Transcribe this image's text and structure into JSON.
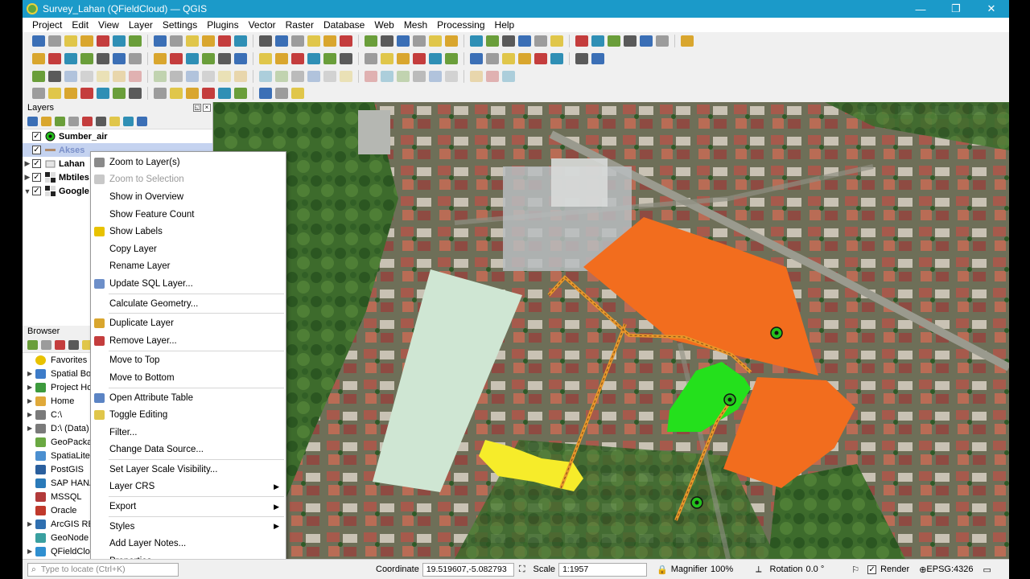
{
  "window": {
    "title": "Survey_Lahan (QFieldCloud) — QGIS",
    "controls": [
      "—",
      "❐",
      "✕"
    ]
  },
  "menubar": [
    "Project",
    "Edit",
    "View",
    "Layer",
    "Settings",
    "Plugins",
    "Vector",
    "Raster",
    "Database",
    "Web",
    "Mesh",
    "Processing",
    "Help"
  ],
  "layers_panel": {
    "title": "Layers",
    "layers": [
      {
        "name": "Sumber_air",
        "checked": true,
        "icon": "point-layer-icon"
      },
      {
        "name": "Akses",
        "checked": true,
        "icon": "line-layer-icon",
        "selected": true
      },
      {
        "name": "Lahan",
        "checked": true,
        "icon": "polygon-layer-icon"
      },
      {
        "name": "Mbtiles",
        "checked": true,
        "icon": "raster-layer-icon"
      },
      {
        "name": "Google",
        "checked": true,
        "icon": "raster-layer-icon"
      }
    ]
  },
  "browser_panel": {
    "title": "Browser",
    "items": [
      "Favorites",
      "Spatial Bookmarks",
      "Project Home",
      "Home",
      "C:\\",
      "D:\\ (Data)",
      "GeoPackage",
      "SpatiaLite",
      "PostGIS",
      "SAP HANA",
      "MSSQL",
      "Oracle",
      "ArcGIS REST Servers",
      "GeoNode",
      "QFieldCloud"
    ]
  },
  "context_menu": {
    "groups": [
      [
        {
          "label": "Zoom to Layer(s)",
          "icon": "zoom-layer-icon"
        },
        {
          "label": "Zoom to Selection",
          "icon": "zoom-selection-icon",
          "disabled": true
        },
        {
          "label": "Show in Overview",
          "icon": ""
        },
        {
          "label": "Show Feature Count",
          "icon": ""
        },
        {
          "label": "Show Labels",
          "icon": "labels-icon"
        },
        {
          "label": "Copy Layer",
          "icon": ""
        },
        {
          "label": "Rename Layer",
          "icon": ""
        },
        {
          "label": "Update SQL Layer...",
          "icon": "database-icon"
        }
      ],
      [
        {
          "label": "Calculate Geometry...",
          "icon": ""
        }
      ],
      [
        {
          "label": "Duplicate Layer",
          "icon": "duplicate-icon"
        },
        {
          "label": "Remove Layer...",
          "icon": "remove-icon"
        }
      ],
      [
        {
          "label": "Move to Top",
          "icon": ""
        },
        {
          "label": "Move to Bottom",
          "icon": ""
        }
      ],
      [
        {
          "label": "Open Attribute Table",
          "icon": "table-icon"
        },
        {
          "label": "Toggle Editing",
          "icon": "pencil-icon"
        },
        {
          "label": "Filter...",
          "icon": ""
        },
        {
          "label": "Change Data Source...",
          "icon": ""
        }
      ],
      [
        {
          "label": "Set Layer Scale Visibility...",
          "icon": ""
        },
        {
          "label": "Layer CRS",
          "icon": "",
          "submenu": true
        }
      ],
      [
        {
          "label": "Export",
          "icon": "",
          "submenu": true
        }
      ],
      [
        {
          "label": "Styles",
          "icon": "",
          "submenu": true
        },
        {
          "label": "Add Layer Notes...",
          "icon": ""
        },
        {
          "label": "Properties...",
          "icon": ""
        }
      ]
    ]
  },
  "statusbar": {
    "locate_placeholder": "Type to locate (Ctrl+K)",
    "coordinate_label": "Coordinate",
    "coordinate_value": "19.519607,-5.082793",
    "scale_label": "Scale",
    "scale_value": "1:1957",
    "magnifier_label": "Magnifier",
    "magnifier_value": "100%",
    "rotation_label": "Rotation",
    "rotation_value": "0.0 °",
    "render_label": "Render",
    "crs_label": "EPSG:4326"
  },
  "colors": {
    "titlebar": "#1b9ac9",
    "lahan_orange": "#f26d1e",
    "lahan_green": "#24e01c",
    "lahan_yellow": "#f6ec2a",
    "lahan_pale": "#cfe6d3",
    "akses_line": "#e8972a",
    "selection": "#c5d3f0"
  }
}
